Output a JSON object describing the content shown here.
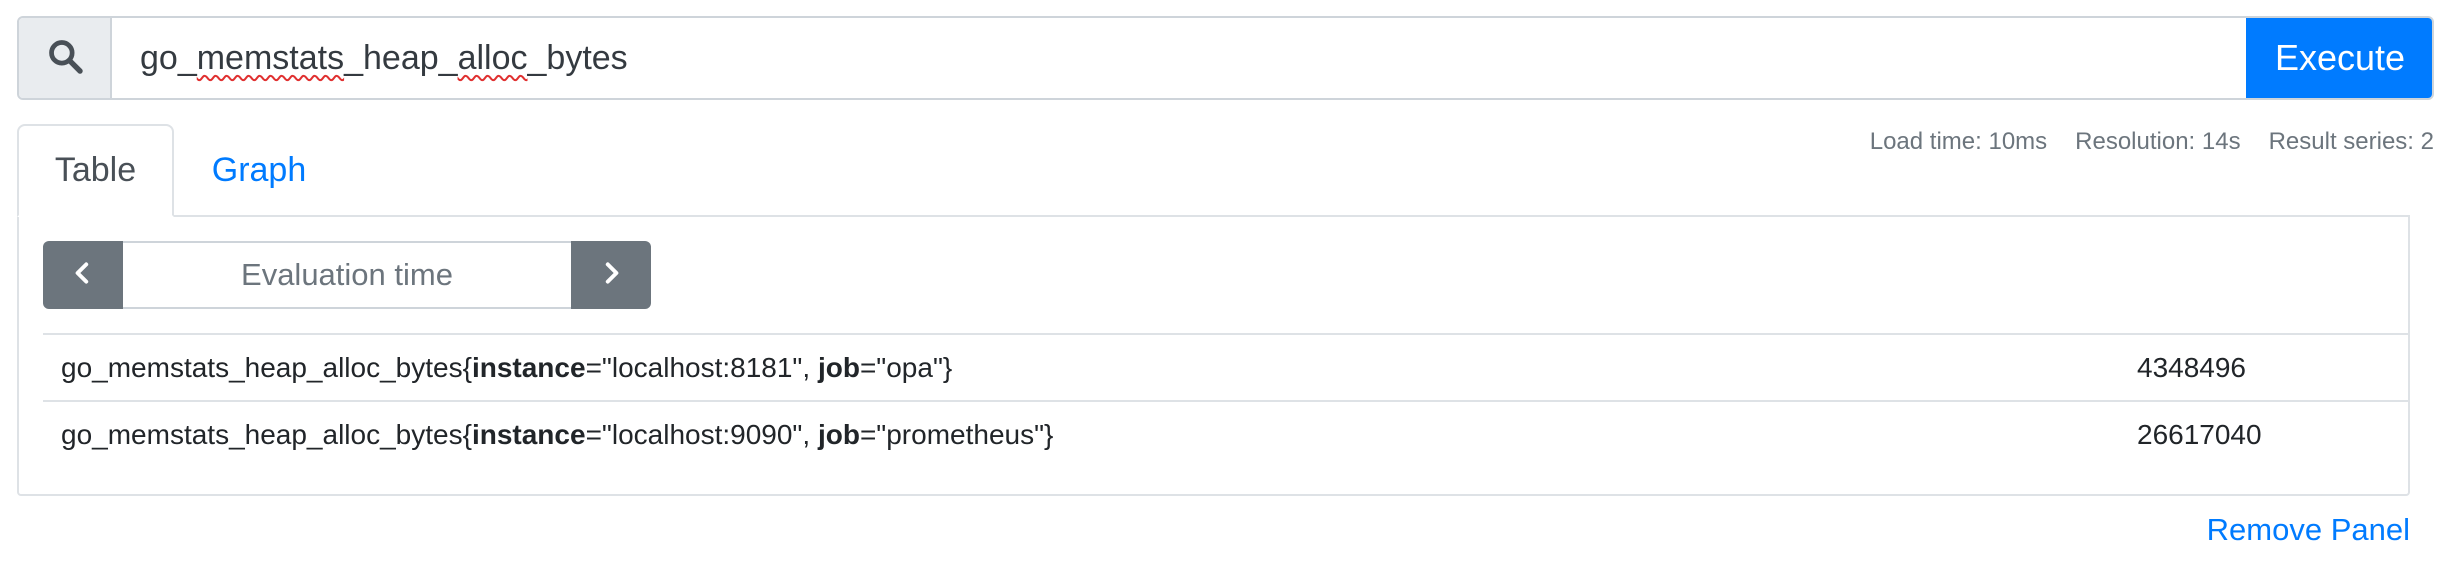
{
  "query": {
    "icon": "search-icon",
    "expression_parts": [
      "go_",
      "memstats",
      "_heap_",
      "alloc",
      "_bytes"
    ],
    "execute_label": "Execute"
  },
  "tabs": [
    {
      "label": "Table",
      "active": true
    },
    {
      "label": "Graph",
      "active": false
    }
  ],
  "stats": {
    "load_time": "Load time: 10ms",
    "resolution": "Resolution: 14s",
    "result_series": "Result series: 2"
  },
  "time_control": {
    "prev_icon": "chevron-left-icon",
    "placeholder": "Evaluation time",
    "next_icon": "chevron-right-icon"
  },
  "results": [
    {
      "metric_name": "go_memstats_heap_alloc_bytes",
      "open": "{",
      "label1_key": "instance",
      "label1_eq": "=\"localhost:8181\", ",
      "label2_key": "job",
      "label2_eq": "=\"opa\"",
      "close": "}",
      "value": "4348496"
    },
    {
      "metric_name": "go_memstats_heap_alloc_bytes",
      "open": "{",
      "label1_key": "instance",
      "label1_eq": "=\"localhost:9090\", ",
      "label2_key": "job",
      "label2_eq": "=\"prometheus\"",
      "close": "}",
      "value": "26617040"
    }
  ],
  "remove_panel_label": "Remove Panel",
  "colors": {
    "primary": "#007bff",
    "secondary": "#6c757d",
    "border": "#dee2e6",
    "prepend_bg": "#e9ecef"
  }
}
